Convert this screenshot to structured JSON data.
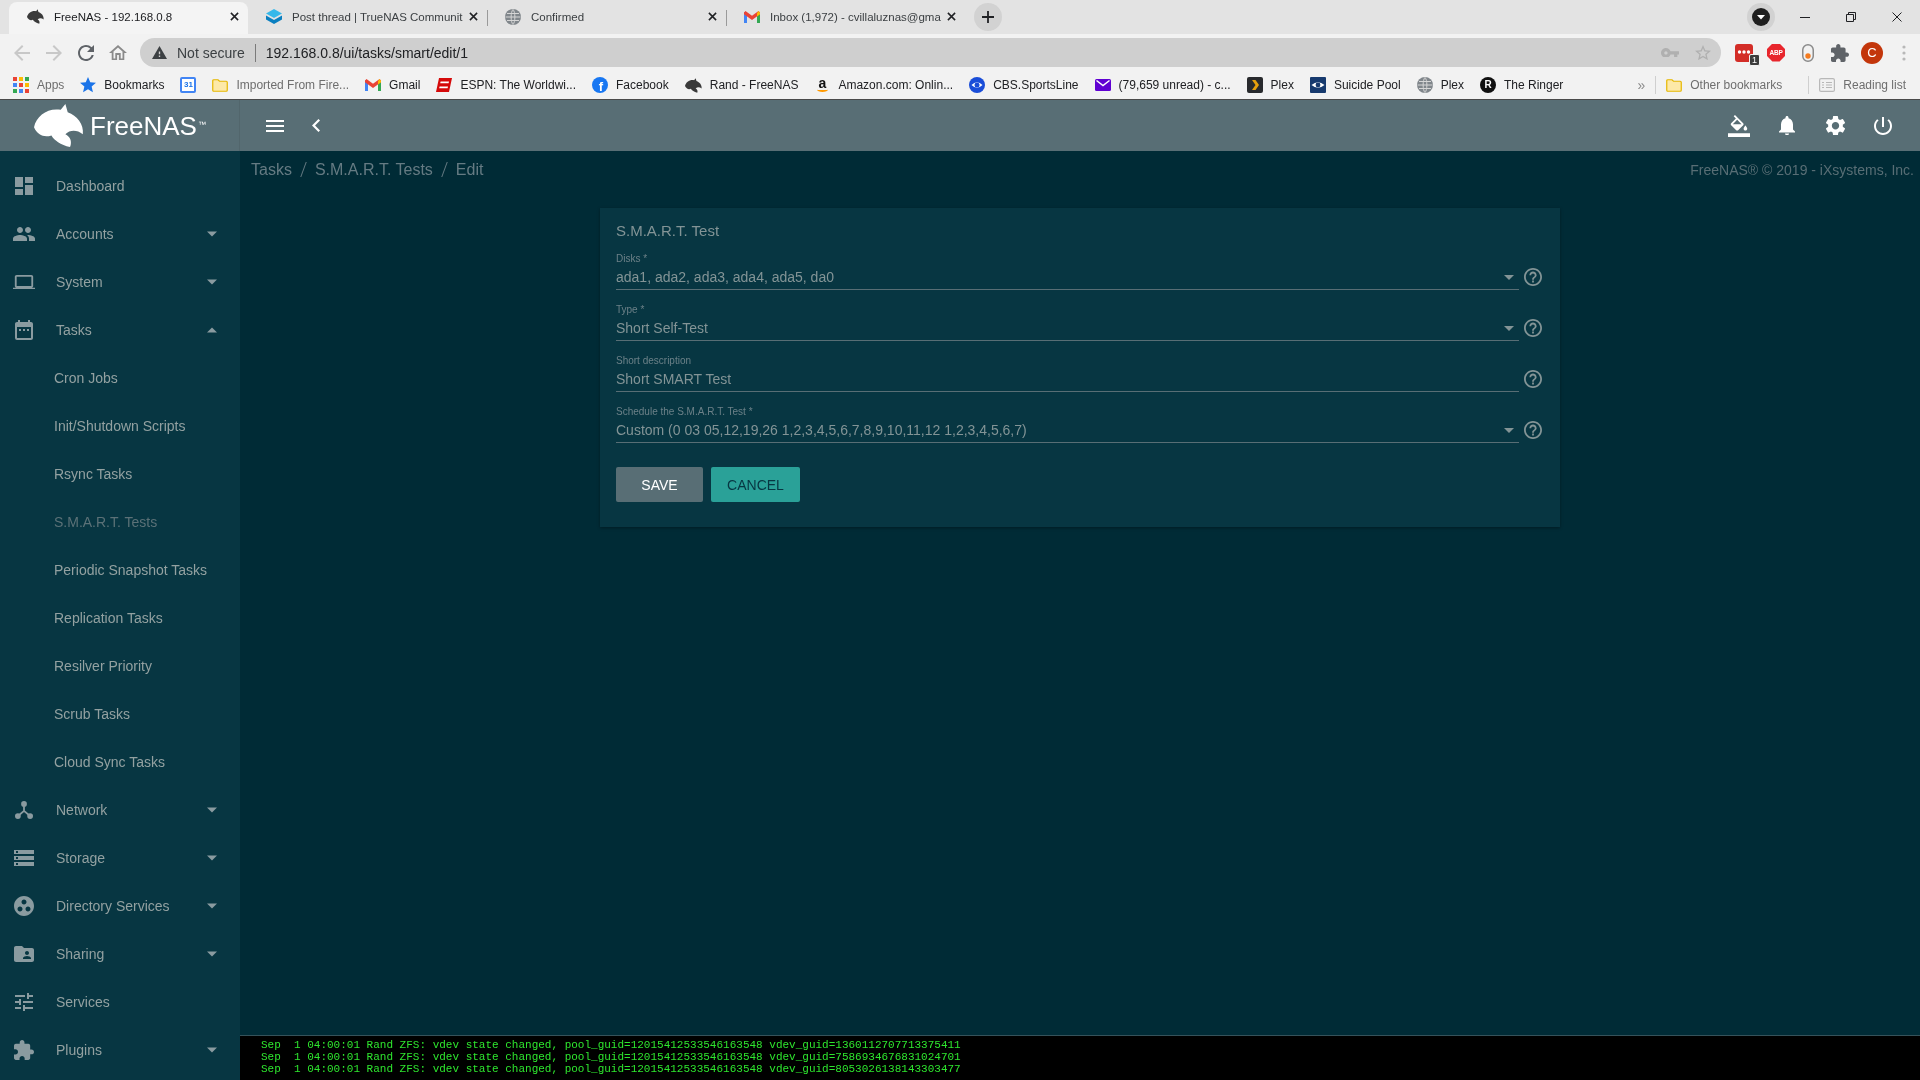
{
  "browser": {
    "tabs": [
      {
        "title": "FreeNAS - 192.168.0.8",
        "selected": true
      },
      {
        "title": "Post thread | TrueNAS Communit",
        "selected": false
      },
      {
        "title": "Confirmed",
        "selected": false
      },
      {
        "title": "Inbox (1,972) - cvillaluznas@gma",
        "selected": false
      }
    ],
    "navigation": {
      "back_disabled": true,
      "forward_disabled": true
    },
    "address_bar": {
      "security_label": "Not secure",
      "url": "192.168.0.8/ui/tasks/smart/edit/1"
    },
    "extensions": {
      "badge_count": "1",
      "blocker_label": "ABP",
      "profile_initial": "C"
    },
    "bookmarks": [
      {
        "label": "Apps",
        "kind": "apps"
      },
      {
        "label": "Bookmarks",
        "kind": "site"
      },
      {
        "kind": "site",
        "icon_text": "31"
      },
      {
        "label": "Imported From Fire...",
        "kind": "folder"
      },
      {
        "label": "Gmail",
        "kind": "site"
      },
      {
        "label": "ESPN: The Worldwi...",
        "kind": "site"
      },
      {
        "label": "Facebook",
        "kind": "site",
        "icon_text": "f"
      },
      {
        "label": "Rand - FreeNAS",
        "kind": "site"
      },
      {
        "label": "Amazon.com: Onlin...",
        "kind": "site",
        "icon_text": "a"
      },
      {
        "label": "CBS.SportsLine",
        "kind": "site"
      },
      {
        "label": "(79,659 unread) - c...",
        "kind": "site"
      },
      {
        "label": "Plex",
        "kind": "site"
      },
      {
        "label": "Suicide Pool",
        "kind": "site"
      },
      {
        "label": "Plex",
        "kind": "site"
      },
      {
        "label": "The Ringer",
        "kind": "site",
        "icon_text": "R"
      }
    ],
    "bookmarks_overflow": "»",
    "bookmark_folders": [
      {
        "label": "Other bookmarks"
      },
      {
        "label": "Reading list"
      }
    ]
  },
  "app": {
    "logo": {
      "wordmark": "FreeNAS$^{™}$"
    },
    "sidebar": {
      "items": [
        {
          "label": "Dashboard",
          "kind": "link"
        },
        {
          "label": "Accounts",
          "kind": "group",
          "expanded": false
        },
        {
          "label": "System",
          "kind": "group",
          "expanded": false
        },
        {
          "label": "Tasks",
          "kind": "group",
          "expanded": true,
          "children": [
            {
              "label": "Cron Jobs",
              "selected": false
            },
            {
              "label": "Init/Shutdown Scripts",
              "selected": false
            },
            {
              "label": "Rsync Tasks",
              "selected": false
            },
            {
              "label": "S.M.A.R.T. Tests",
              "selected": true
            },
            {
              "label": "Periodic Snapshot Tasks",
              "selected": false
            },
            {
              "label": "Replication Tasks",
              "selected": false
            },
            {
              "label": "Resilver Priority",
              "selected": false
            },
            {
              "label": "Scrub Tasks",
              "selected": false
            },
            {
              "label": "Cloud Sync Tasks",
              "selected": false
            }
          ]
        },
        {
          "label": "Network",
          "kind": "group",
          "expanded": false
        },
        {
          "label": "Storage",
          "kind": "group",
          "expanded": false
        },
        {
          "label": "Directory Services",
          "kind": "group",
          "expanded": false
        },
        {
          "label": "Sharing",
          "kind": "group",
          "expanded": false
        },
        {
          "label": "Services",
          "kind": "link"
        },
        {
          "label": "Plugins",
          "kind": "group",
          "expanded": false
        }
      ]
    },
    "breadcrumb": [
      "Tasks",
      "S.M.A.R.T. Tests",
      "Edit"
    ],
    "copyright": "FreeNAS® © 2019 - iXsystems, Inc.",
    "form": {
      "title": "S.M.A.R.T. Test",
      "fields": [
        {
          "kind": "select",
          "label": "Disks *",
          "value": "ada1, ada2, ada3, ada4, ada5, da0"
        },
        {
          "kind": "select",
          "label": "Type *",
          "value": "Short Self-Test"
        },
        {
          "kind": "input",
          "label": "Short description",
          "value": "Short SMART Test"
        },
        {
          "kind": "select",
          "label": "Schedule the S.M.A.R.T. Test *",
          "value": "Custom (0 03 05,12,19,26 1,2,3,4,5,6,7,8,9,10,11,12 1,2,3,4,5,6,7)"
        }
      ],
      "buttons": [
        {
          "kind": "submit",
          "label": "SAVE"
        },
        {
          "kind": "cancel",
          "label": "CANCEL"
        }
      ]
    },
    "console": {
      "lines": [
        "Sep  1 04:00:01 Rand ZFS: vdev state changed, pool_guid=12015412533546163548 vdev_guid=1360112707713375411",
        "Sep  1 04:00:01 Rand ZFS: vdev state changed, pool_guid=12015412533546163548 vdev_guid=7586934676831024701",
        "Sep  1 04:00:01 Rand ZFS: vdev state changed, pool_guid=12015412533546163548 vdev_guid=8053026138143303477"
      ]
    }
  }
}
